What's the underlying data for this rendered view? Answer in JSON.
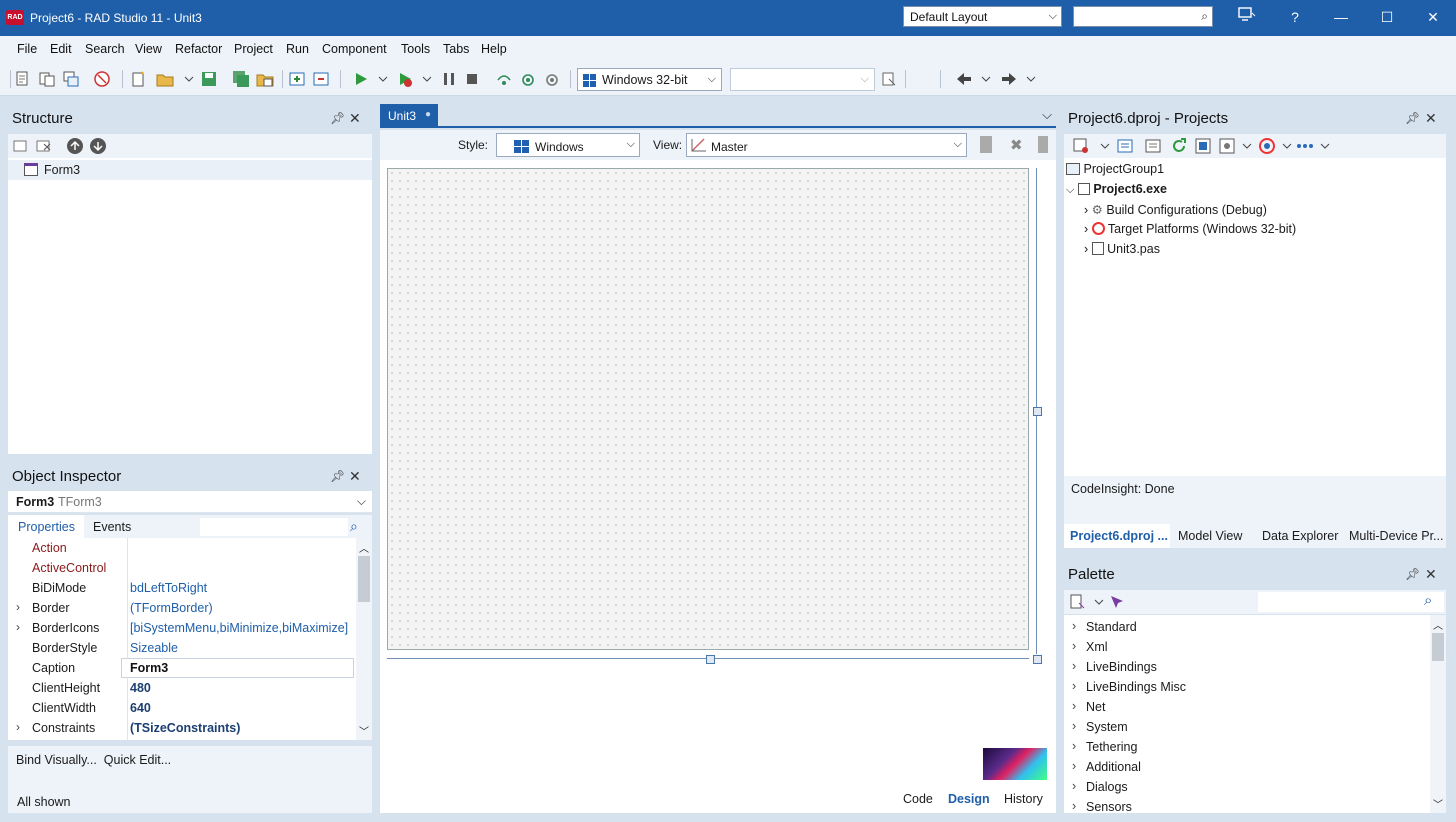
{
  "window": {
    "title": "Project6 - RAD Studio 11 - Unit3",
    "logo_text": "RAD",
    "layout": "Default Layout",
    "help": "?"
  },
  "menu": [
    "File",
    "Edit",
    "Search",
    "View",
    "Refactor",
    "Project",
    "Run",
    "Component",
    "Tools",
    "Tabs",
    "Help"
  ],
  "toolbar": {
    "platform": "Windows 32-bit",
    "config": ""
  },
  "structure": {
    "title": "Structure",
    "root": "Form3"
  },
  "object_inspector": {
    "title": "Object Inspector",
    "selected_name": "Form3",
    "selected_type": "TForm3",
    "tabs": [
      "Properties",
      "Events"
    ],
    "rows": [
      {
        "name": "Action",
        "value": "",
        "exp": false,
        "style": "ref"
      },
      {
        "name": "ActiveControl",
        "value": "",
        "exp": false,
        "style": "ref"
      },
      {
        "name": "BiDiMode",
        "value": "bdLeftToRight",
        "exp": false,
        "style": "val"
      },
      {
        "name": "Border",
        "value": "(TFormBorder)",
        "exp": true,
        "style": "val"
      },
      {
        "name": "BorderIcons",
        "value": "[biSystemMenu,biMinimize,biMaximize]",
        "exp": true,
        "style": "val"
      },
      {
        "name": "BorderStyle",
        "value": "Sizeable",
        "exp": false,
        "style": "val"
      },
      {
        "name": "Caption",
        "value": "Form3",
        "exp": false,
        "style": "edit"
      },
      {
        "name": "ClientHeight",
        "value": "480",
        "exp": false,
        "style": "bold"
      },
      {
        "name": "ClientWidth",
        "value": "640",
        "exp": false,
        "style": "bold"
      },
      {
        "name": "Constraints",
        "value": "(TSizeConstraints)",
        "exp": true,
        "style": "bold"
      }
    ],
    "links": "Bind Visually...  Quick Edit...",
    "status": "All shown"
  },
  "designer": {
    "tab": "Unit3",
    "style_label": "Style:",
    "style_value": "Windows",
    "view_label": "View:",
    "view_value": "Master",
    "bottom_tabs": [
      "Code",
      "Design",
      "History"
    ]
  },
  "projects": {
    "title": "Project6.dproj - Projects",
    "group": "ProjectGroup1",
    "project": "Project6.exe",
    "children": [
      "Build Configurations (Debug)",
      "Target Platforms (Windows 32-bit)",
      "Unit3.pas"
    ],
    "status": "CodeInsight: Done",
    "tabs": [
      "Project6.dproj ...",
      "Model View",
      "Data Explorer",
      "Multi-Device Pr..."
    ]
  },
  "palette": {
    "title": "Palette",
    "categories": [
      "Standard",
      "Xml",
      "LiveBindings",
      "LiveBindings Misc",
      "Net",
      "System",
      "Tethering",
      "Additional",
      "Dialogs",
      "Sensors"
    ]
  }
}
